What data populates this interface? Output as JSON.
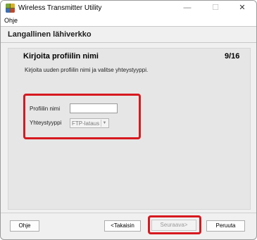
{
  "window": {
    "title": "Wireless Transmitter Utility",
    "controls": {
      "minimize": "—",
      "maximize": "☐",
      "close": "✕"
    }
  },
  "menu": {
    "items": [
      "Ohje"
    ]
  },
  "header": {
    "title": "Langallinen lähiverkko"
  },
  "step": {
    "title": "Kirjoita profiilin nimi",
    "counter": "9/16",
    "description": "Kirjoita uuden profiilin nimi ja valitse yhteystyyppi."
  },
  "form": {
    "profile_name_label": "Profiilin nimi",
    "profile_name_value": "",
    "connection_type_label": "Yhteystyyppi",
    "connection_type_value": "FTP-lataus"
  },
  "buttons": {
    "help": "Ohje",
    "back": "<Takaisin",
    "next": "Seuraava>",
    "cancel": "Peruuta"
  },
  "colors": {
    "highlight": "#d7191f",
    "window_bg": "#f0f0f0",
    "panel_bg": "#e6e6e6"
  }
}
